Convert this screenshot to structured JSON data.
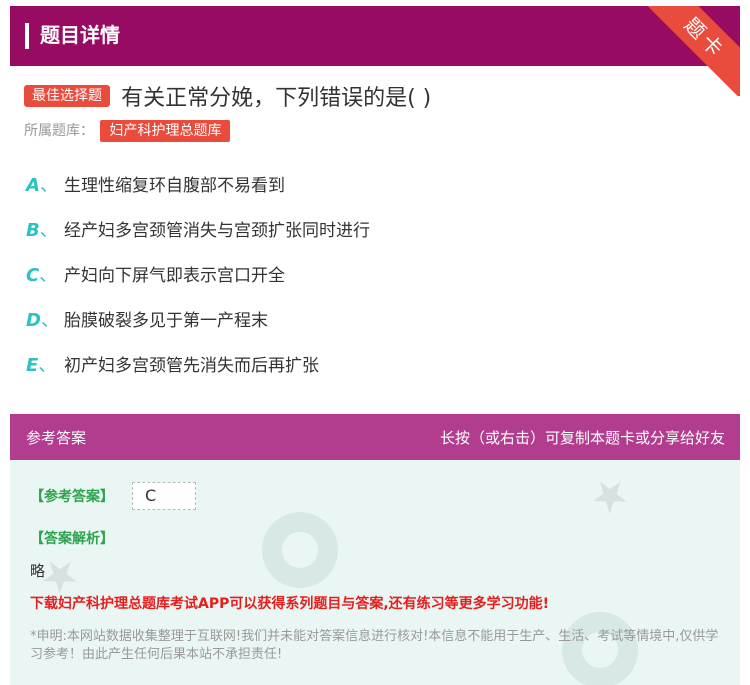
{
  "header": {
    "title": "题目详情",
    "corner_label": "题卡"
  },
  "question": {
    "type_label": "最佳选择题",
    "text": "有关正常分娩，下列错误的是( )",
    "bank_prefix": "所属题库：",
    "bank_name": "妇产科护理总题库"
  },
  "options": [
    {
      "letter": "A",
      "sep": "、",
      "text": "生理性缩复环自腹部不易看到"
    },
    {
      "letter": "B",
      "sep": "、",
      "text": "经产妇多宫颈管消失与宫颈扩张同时进行"
    },
    {
      "letter": "C",
      "sep": "、",
      "text": "产妇向下屏气即表示宫口开全"
    },
    {
      "letter": "D",
      "sep": "、",
      "text": "胎膜破裂多见于第一产程末"
    },
    {
      "letter": "E",
      "sep": "、",
      "text": "初产妇多宫颈管先消失而后再扩张"
    }
  ],
  "answer_bar": {
    "left": "参考答案",
    "right": "长按（或右击）可复制本题卡或分享给好友"
  },
  "answer": {
    "label": "【参考答案】",
    "value": "C",
    "explanation_label": "【答案解析】",
    "explanation": "略",
    "promo": "下载妇产科护理总题库考试APP可以获得系列题目与答案,还有练习等更多学习功能!",
    "disclaimer": "*申明:本网站数据收集整理于互联网!我们并未能对答案信息进行核对!本信息不能用于生产、生活、考试等情境中,仅供学习参考！由此产生任何后果本站不承担责任!"
  },
  "colors": {
    "header": "#980b62",
    "accent_red": "#e94c3d",
    "option_letter": "#2bc2c4",
    "answer_bar": "#b23c8e",
    "answer_bg": "#eaf6f4"
  }
}
